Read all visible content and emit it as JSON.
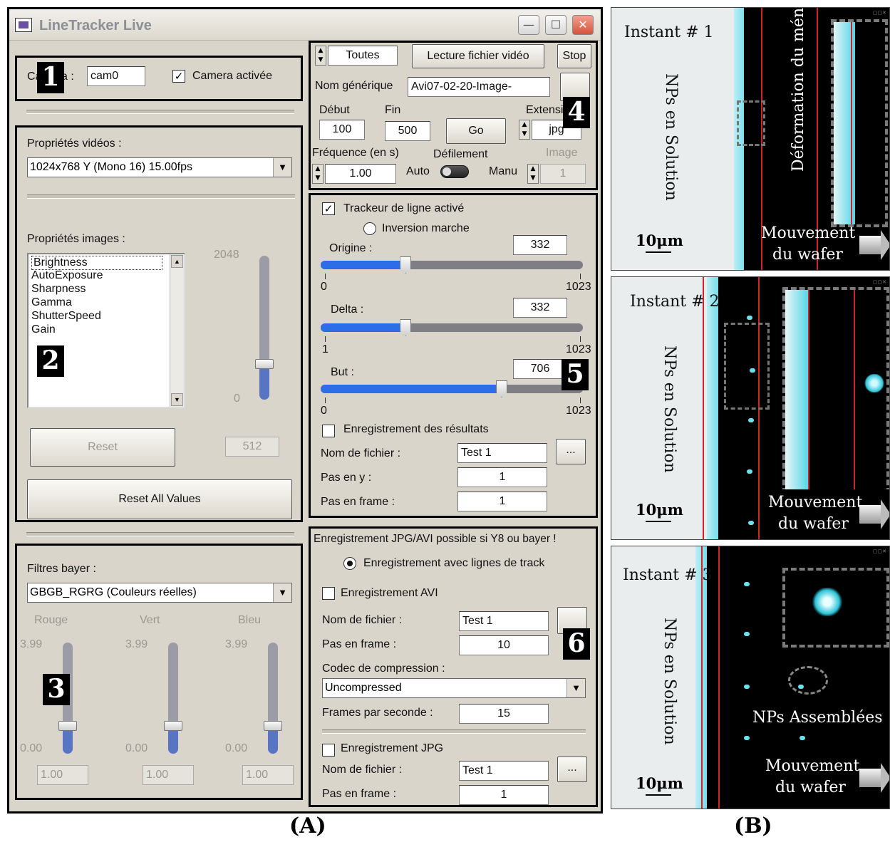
{
  "window": {
    "title": "LineTracker Live",
    "min_label": "—",
    "max_label": "☐",
    "close_label": "✕"
  },
  "badges": [
    "1",
    "2",
    "3",
    "4",
    "5",
    "6"
  ],
  "camera": {
    "label": "Camera :",
    "value": "cam0",
    "enabled_label": "Camera activée",
    "enabled": true
  },
  "video": {
    "label": "Propriétés vidéos :",
    "selected": "1024x768 Y (Mono 16) 15.00fps"
  },
  "images": {
    "label": "Propriétés images :",
    "items": [
      "Brightness",
      "AutoExposure",
      "Sharpness",
      "Gamma",
      "ShutterSpeed",
      "Gain"
    ],
    "slider_max": "2048",
    "slider_min": "0",
    "slider_value": "512",
    "slider_fraction": 0.25,
    "reset_label": "Reset",
    "reset_all_label": "Reset All Values"
  },
  "bayer": {
    "label": "Filtres bayer :",
    "selected": "GBGB_RGRG (Couleurs réelles)",
    "channels": [
      {
        "name": "Rouge",
        "max": "3.99",
        "min": "0.00",
        "value": "1.00",
        "fraction": 0.25
      },
      {
        "name": "Vert",
        "max": "3.99",
        "min": "0.00",
        "value": "1.00",
        "fraction": 0.25
      },
      {
        "name": "Bleu",
        "max": "3.99",
        "min": "0.00",
        "value": "1.00",
        "fraction": 0.25
      }
    ]
  },
  "file": {
    "mode": "Toutes",
    "read_label": "Lecture fichier vidéo",
    "stop_label": "Stop",
    "generic_label": "Nom générique",
    "generic_value": "Avi07-02-20-Image-",
    "debut_label": "Début",
    "debut_value": "100",
    "fin_label": "Fin",
    "fin_value": "500",
    "go_label": "Go",
    "ext_label": "Extension",
    "ext_value": "jpg",
    "freq_label": "Fréquence (en s)",
    "freq_value": "1.00",
    "defil_label": "Défilement",
    "auto_label": "Auto",
    "manu_label": "Manu",
    "image_label": "Image",
    "image_value": "1"
  },
  "tracker": {
    "active_label": "Trackeur de ligne activé",
    "active": true,
    "inversion_label": "Inversion marche",
    "sliders": [
      {
        "label": "Origine :",
        "value": "332",
        "min": "0",
        "max": "1023",
        "fraction": 0.3245
      },
      {
        "label": "Delta :",
        "value": "332",
        "min": "1",
        "max": "1023",
        "fraction": 0.3245
      },
      {
        "label": "But :",
        "value": "706",
        "min": "0",
        "max": "1023",
        "fraction": 0.69
      }
    ],
    "save_label": "Enregistrement des résultats",
    "filename_label": "Nom de fichier :",
    "filename_value": "Test 1",
    "browse_label": "...",
    "pas_y_label": "Pas en y :",
    "pas_y_value": "1",
    "pas_frame_label": "Pas en frame :",
    "pas_frame_value": "1"
  },
  "record": {
    "note": "Enregistrement JPG/AVI possible si Y8 ou bayer !",
    "with_lines_label": "Enregistrement avec lignes de track",
    "avi_label": "Enregistrement AVI",
    "avi_filename_label": "Nom de fichier :",
    "avi_filename_value": "Test 1",
    "avi_pas_frame_label": "Pas en frame :",
    "avi_pas_frame_value": "10",
    "codec_label": "Codec de compression :",
    "codec_value": "Uncompressed",
    "fps_label": "Frames par seconde :",
    "fps_value": "15",
    "jpg_label": "Enregistrement JPG",
    "jpg_filename_label": "Nom de fichier :",
    "jpg_filename_value": "Test 1",
    "jpg_browse_label": "...",
    "jpg_pas_frame_label": "Pas en frame :",
    "jpg_pas_frame_value": "1"
  },
  "micrographs": [
    {
      "instant": "Instant # 1",
      "side_label": "NPs en Solution",
      "inset_label": "Déformation du ménisque",
      "scale": "10μm",
      "move1": "Mouvement",
      "move2": "du  wafer"
    },
    {
      "instant": "Instant # 2",
      "side_label": "NPs en Solution",
      "scale": "10μm",
      "move1": "Mouvement",
      "move2": "du  wafer"
    },
    {
      "instant": "Instant # 3",
      "side_label": "NPs en Solution",
      "assembled_label": "NPs Assemblées",
      "scale": "10μm",
      "move1": "Mouvement",
      "move2": "du  wafer"
    }
  ],
  "captions": {
    "a": "(A)",
    "b": "(B)"
  }
}
